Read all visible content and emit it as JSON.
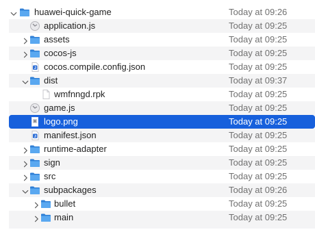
{
  "colors": {
    "folder": "#2f7fd6",
    "folder_light": "#5aa8f0",
    "selection": "#1760dc",
    "date_text": "#707070",
    "stripe": "#f4f4f5"
  },
  "rows": [
    {
      "name": "huawei-quick-game",
      "date": "Today at 09:26",
      "icon": "folder-icon",
      "level": 0,
      "expander": "chevron-down-icon"
    },
    {
      "name": "application.js",
      "date": "Today at 09:25",
      "icon": "script-file-icon",
      "level": 1,
      "expander": null
    },
    {
      "name": "assets",
      "date": "Today at 09:25",
      "icon": "folder-icon",
      "level": 1,
      "expander": "chevron-right-icon"
    },
    {
      "name": "cocos-js",
      "date": "Today at 09:25",
      "icon": "folder-icon",
      "level": 1,
      "expander": "chevron-right-icon"
    },
    {
      "name": "cocos.compile.config.json",
      "date": "Today at 09:25",
      "icon": "json-file-icon",
      "level": 1,
      "expander": null
    },
    {
      "name": "dist",
      "date": "Today at 09:37",
      "icon": "folder-icon",
      "level": 1,
      "expander": "chevron-down-icon"
    },
    {
      "name": "wmfnngd.rpk",
      "date": "Today at 09:25",
      "icon": "document-file-icon",
      "level": 2,
      "expander": null
    },
    {
      "name": "game.js",
      "date": "Today at 09:25",
      "icon": "script-file-icon",
      "level": 1,
      "expander": null
    },
    {
      "name": "logo.png",
      "date": "Today at 09:25",
      "icon": "image-file-icon",
      "level": 1,
      "expander": null,
      "selected": true
    },
    {
      "name": "manifest.json",
      "date": "Today at 09:25",
      "icon": "json-file-icon",
      "level": 1,
      "expander": null
    },
    {
      "name": "runtime-adapter",
      "date": "Today at 09:25",
      "icon": "folder-icon",
      "level": 1,
      "expander": "chevron-right-icon"
    },
    {
      "name": "sign",
      "date": "Today at 09:25",
      "icon": "folder-icon",
      "level": 1,
      "expander": "chevron-right-icon"
    },
    {
      "name": "src",
      "date": "Today at 09:25",
      "icon": "folder-icon",
      "level": 1,
      "expander": "chevron-right-icon"
    },
    {
      "name": "subpackages",
      "date": "Today at 09:26",
      "icon": "folder-icon",
      "level": 1,
      "expander": "chevron-down-icon"
    },
    {
      "name": "bullet",
      "date": "Today at 09:25",
      "icon": "folder-icon",
      "level": 2,
      "expander": "chevron-right-icon"
    },
    {
      "name": "main",
      "date": "Today at 09:25",
      "icon": "folder-icon",
      "level": 2,
      "expander": "chevron-right-icon"
    }
  ]
}
